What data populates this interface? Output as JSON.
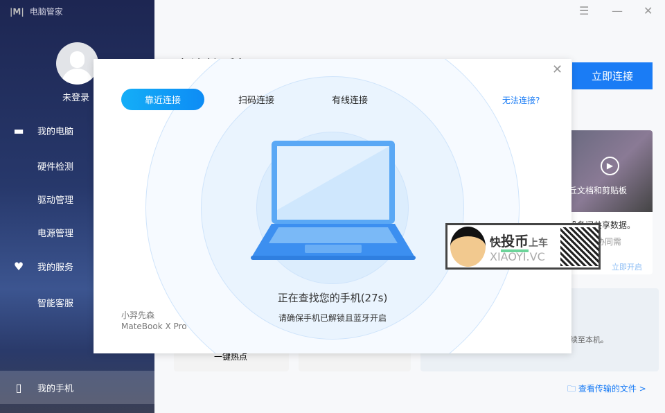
{
  "app": {
    "title": "电脑管家"
  },
  "sidebar": {
    "login": "未登录",
    "items": [
      {
        "label": "我的电脑",
        "icon": "laptop-icon"
      },
      {
        "label": "硬件检测"
      },
      {
        "label": "驱动管理"
      },
      {
        "label": "电源管理"
      },
      {
        "label": "我的服务",
        "icon": "heart-icon"
      },
      {
        "label": "智能客服"
      },
      {
        "label": "我的手机",
        "icon": "phone-icon"
      }
    ]
  },
  "main": {
    "title": "立连接手机",
    "connect_button": "立即连接",
    "video_caption": "丘文档和剪贴板",
    "card_text1": "设备间共享数据。",
    "card_text2": "协同需",
    "card_link": "立即开启",
    "card3_text": "续至本机。",
    "hotspot": "一键热点",
    "view_files": "查看传输的文件 >"
  },
  "modal": {
    "tabs": [
      "靠近连接",
      "扫码连接",
      "有线连接"
    ],
    "help": "无法连接?",
    "status": "正在查找您的手机(27s)",
    "hint": "请确保手机已解锁且蓝牙开启",
    "device_name": "小羿先森",
    "device_model": "MateBook X Pro"
  },
  "watermark": {
    "text1": "快",
    "text2": "投币",
    "text3": "上车",
    "site": "XIAOYI.VC"
  }
}
